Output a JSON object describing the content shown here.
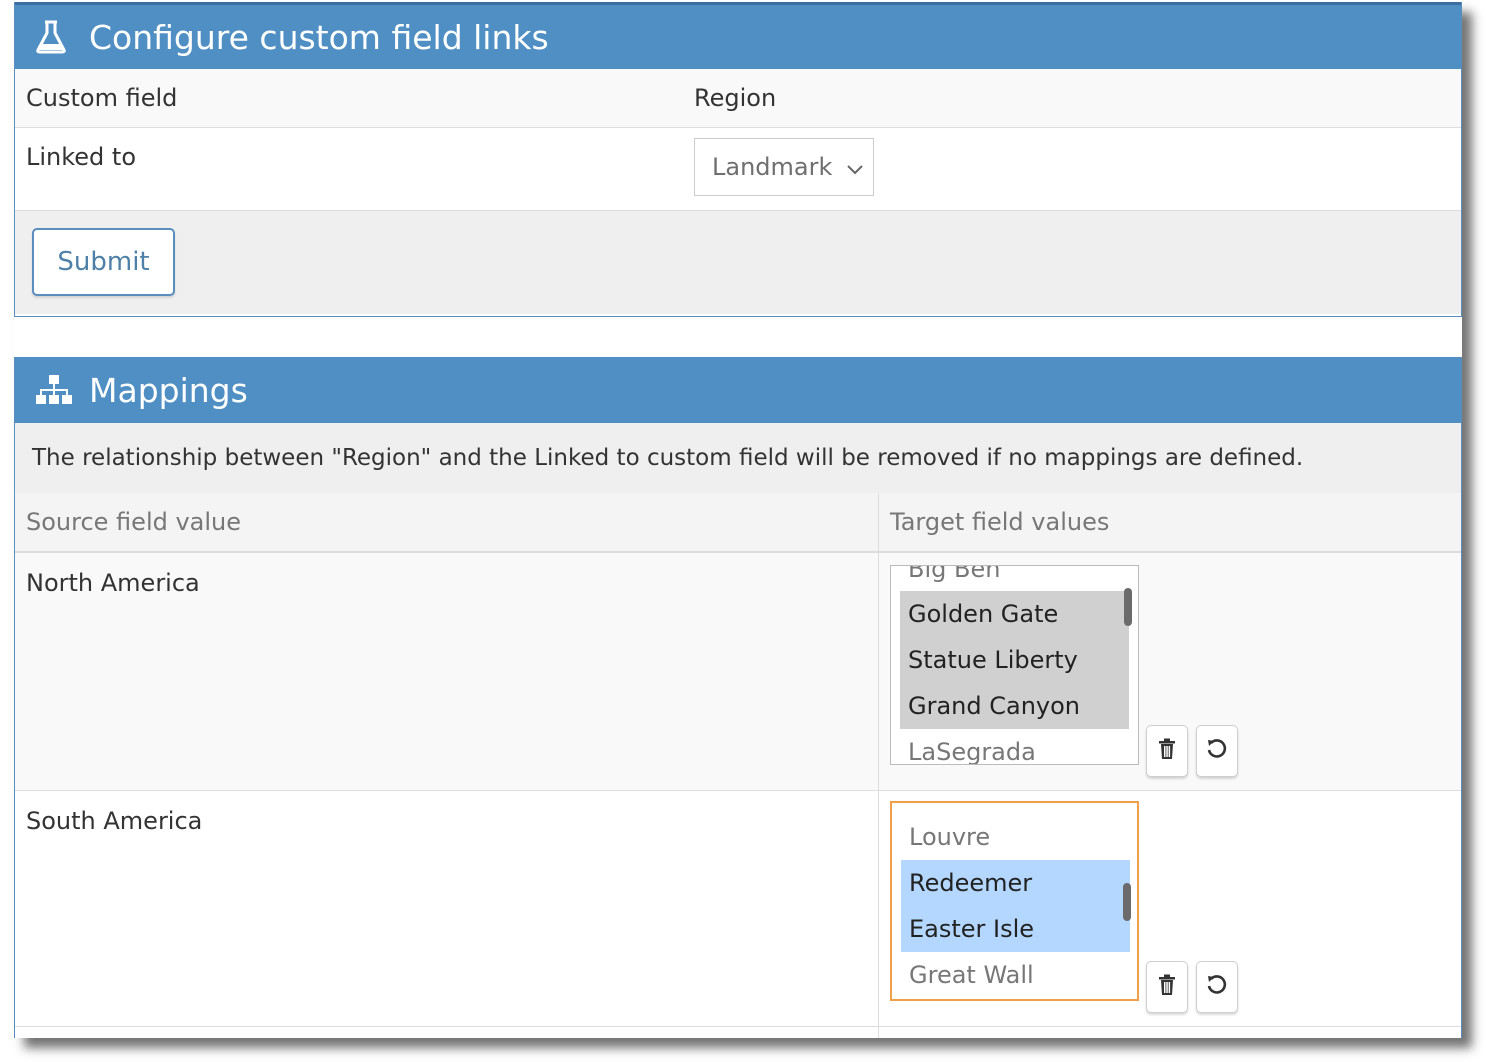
{
  "config": {
    "title": "Configure custom field links",
    "header_icon": "flask-icon",
    "custom_field_label": "Custom field",
    "custom_field_value": "Region",
    "linked_to_label": "Linked to",
    "linked_to_selected": "Landmark",
    "submit_label": "Submit"
  },
  "mappings": {
    "title": "Mappings",
    "header_icon": "sitemap-icon",
    "notice": "The relationship between \"Region\" and the Linked to custom field will be removed if no mappings are defined.",
    "columns": [
      "Source field value",
      "Target field values"
    ],
    "rows": [
      {
        "source": "North America",
        "options": [
          "Big Ben",
          "Golden Gate",
          "Statue Liberty",
          "Grand Canyon",
          "LaSegrada"
        ],
        "selected": [
          "Golden Gate",
          "Statue Liberty",
          "Grand Canyon"
        ],
        "focused": false
      },
      {
        "source": "South America",
        "options": [
          "Louvre",
          "Redeemer",
          "Easter Isle",
          "Great Wall"
        ],
        "selected": [
          "Redeemer",
          "Easter Isle"
        ],
        "focused": true
      }
    ]
  },
  "colors": {
    "header_blue": "#4f8fc4",
    "focus_orange": "#f0a04b",
    "selection_blue": "#b3d7ff",
    "selection_gray": "#d0d0d0"
  }
}
